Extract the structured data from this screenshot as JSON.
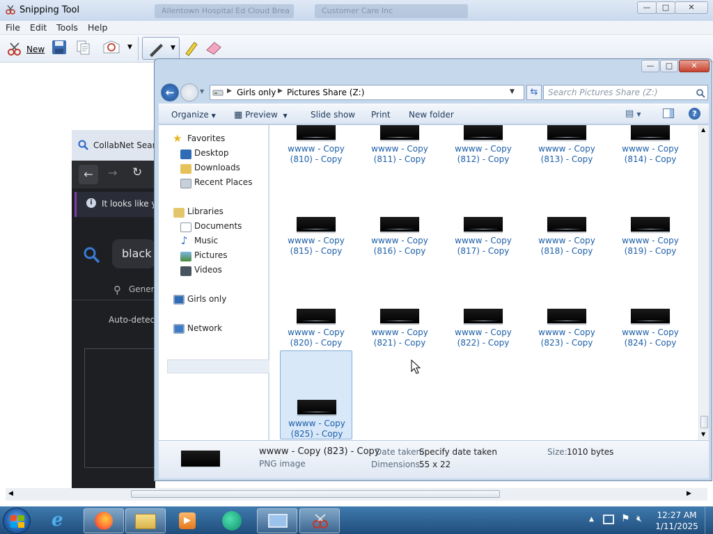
{
  "snipping_tool": {
    "title": "Snipping Tool",
    "ghost_tabs": [
      "Allentown Hospital Ed Cloud Brea",
      "Customer Care Inc"
    ],
    "window_buttons": {
      "minimize": "—",
      "maximize": "□",
      "close": "✕"
    },
    "menu": [
      "File",
      "Edit",
      "Tools",
      "Help"
    ],
    "toolbar": {
      "new_label": "New"
    }
  },
  "browser": {
    "tab_title": "CollabNet SearX",
    "info_text": "It looks like yo",
    "search_text": "black s",
    "general_label": "Gener",
    "auto_detect": "Auto-detec"
  },
  "explorer": {
    "window_buttons": {
      "minimize": "—",
      "maximize": "□",
      "close": "✕"
    },
    "breadcrumb": [
      "Girls only",
      "Pictures Share (Z:)"
    ],
    "search_placeholder": "Search Pictures Share (Z:)",
    "commands": {
      "organize": "Organize",
      "preview": "Preview",
      "slideshow": "Slide show",
      "print": "Print",
      "new_folder": "New folder"
    },
    "nav": {
      "favorites": "Favorites",
      "desktop": "Desktop",
      "downloads": "Downloads",
      "recent": "Recent Places",
      "libraries": "Libraries",
      "documents": "Documents",
      "music": "Music",
      "pictures": "Pictures",
      "videos": "Videos",
      "girls_only": "Girls only",
      "network": "Network"
    },
    "files": [
      {
        "line1": "wwww - Copy",
        "line2": "(810) - Copy"
      },
      {
        "line1": "wwww - Copy",
        "line2": "(811) - Copy"
      },
      {
        "line1": "wwww - Copy",
        "line2": "(812) - Copy"
      },
      {
        "line1": "wwww - Copy",
        "line2": "(813) - Copy"
      },
      {
        "line1": "wwww - Copy",
        "line2": "(814) - Copy"
      },
      {
        "line1": "wwww - Copy",
        "line2": "(815) - Copy"
      },
      {
        "line1": "wwww - Copy",
        "line2": "(816) - Copy"
      },
      {
        "line1": "wwww - Copy",
        "line2": "(817) - Copy"
      },
      {
        "line1": "wwww - Copy",
        "line2": "(818) - Copy"
      },
      {
        "line1": "wwww - Copy",
        "line2": "(819) - Copy"
      },
      {
        "line1": "wwww - Copy",
        "line2": "(820) - Copy"
      },
      {
        "line1": "wwww - Copy",
        "line2": "(821) - Copy"
      },
      {
        "line1": "wwww - Copy",
        "line2": "(822) - Copy"
      },
      {
        "line1": "wwww - Copy",
        "line2": "(823) - Copy"
      },
      {
        "line1": "wwww - Copy",
        "line2": "(824) - Copy"
      },
      {
        "line1": "wwww - Copy",
        "line2": "(825) - Copy"
      }
    ],
    "details": {
      "name": "wwww - Copy (823) - Copy",
      "type": "PNG image",
      "date_label": "Date taken:",
      "date_value": "Specify date taken",
      "dim_label": "Dimensions:",
      "dim_value": "55 x 22",
      "size_label": "Size:",
      "size_value": "1010 bytes"
    }
  },
  "taskbar": {
    "time": "12:27 AM",
    "date": "1/11/2025"
  },
  "colors": {
    "link_blue": "#1c5ea8",
    "selection": "#d8e8f9",
    "taskbar": "#2a5f93"
  }
}
